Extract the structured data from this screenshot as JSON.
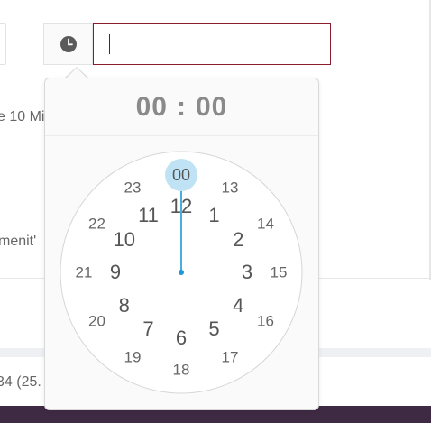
{
  "background": {
    "text_left_1": "e 10 Mi",
    "text_left_2": "menit'",
    "text_left_3": "34 (25."
  },
  "timepicker": {
    "input_value": "",
    "icon": "clock-icon",
    "header": {
      "hours": "00",
      "separator": ":",
      "minutes": "00"
    },
    "selected_hour": "00",
    "colors": {
      "accent": "#1c9ad6",
      "selected_bg": "#bfe3f4",
      "input_border": "#8a1c2c",
      "footer": "#3f2a43"
    },
    "inner_hours": [
      "12",
      "1",
      "2",
      "3",
      "4",
      "5",
      "6",
      "7",
      "8",
      "9",
      "10",
      "11"
    ],
    "outer_hours": [
      "00",
      "13",
      "14",
      "15",
      "16",
      "17",
      "18",
      "19",
      "20",
      "21",
      "22",
      "23"
    ]
  }
}
